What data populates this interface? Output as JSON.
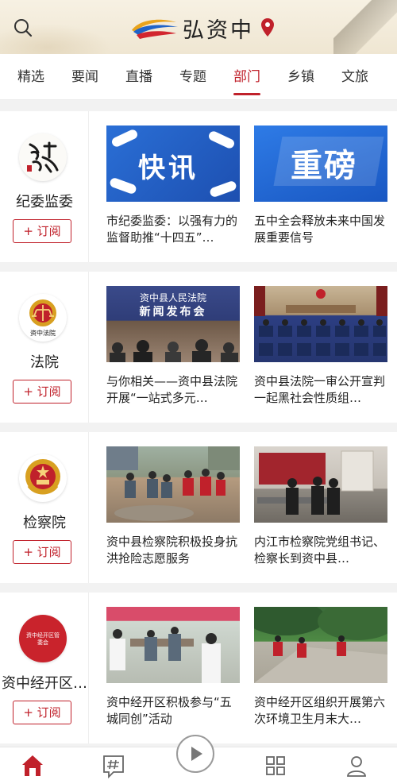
{
  "app": {
    "name": "弘资中"
  },
  "tabs": [
    {
      "label": "精选"
    },
    {
      "label": "要闻"
    },
    {
      "label": "直播"
    },
    {
      "label": "专题"
    },
    {
      "label": "部门",
      "active": true
    },
    {
      "label": "乡镇"
    },
    {
      "label": "文旅"
    }
  ],
  "subscribe_label": "+ 订阅",
  "sections": [
    {
      "dept_name": "纪委监委",
      "logo": {
        "icon": "qinglian-calligraphy-logo",
        "text": "清廉"
      },
      "cards": [
        {
          "title": "市纪委监委：以强有力的监督助推“十四五”…",
          "thumb_text": "快讯"
        },
        {
          "title": "五中全会释放未来中国发展重要信号",
          "thumb_text": "重磅"
        }
      ]
    },
    {
      "dept_name": "法院",
      "logo": {
        "icon": "court-emblem-logo",
        "text": "资中法院"
      },
      "cards": [
        {
          "title": "与你相关——资中县法院开展“一站式多元…",
          "thumb_text": "资中县人民法院",
          "thumb_text2": "新闻发布会"
        },
        {
          "title": "资中县法院一审公开宣判一起黑社会性质组…"
        }
      ]
    },
    {
      "dept_name": "检察院",
      "logo": {
        "icon": "procuratorate-emblem-logo"
      },
      "cards": [
        {
          "title": "资中县检察院积极投身抗洪抢险志愿服务"
        },
        {
          "title": "内江市检察院党组书记、检察长到资中县…"
        }
      ]
    },
    {
      "dept_name": "资中经开区…",
      "logo": {
        "icon": "development-zone-logo",
        "text": "资中经开区管委会"
      },
      "cards": [
        {
          "title": "资中经开区积极参与“五城同创”活动"
        },
        {
          "title": "资中经开区组织开展第六次环境卫生月末大…"
        }
      ]
    }
  ],
  "bottom_nav": [
    {
      "icon": "home-icon",
      "active": true
    },
    {
      "icon": "topic-hash-icon"
    },
    {
      "icon": "play-icon"
    },
    {
      "icon": "grid-apps-icon"
    },
    {
      "icon": "user-profile-icon"
    }
  ],
  "colors": {
    "accent": "#c0212b",
    "header_bg": "#efe6d2"
  }
}
